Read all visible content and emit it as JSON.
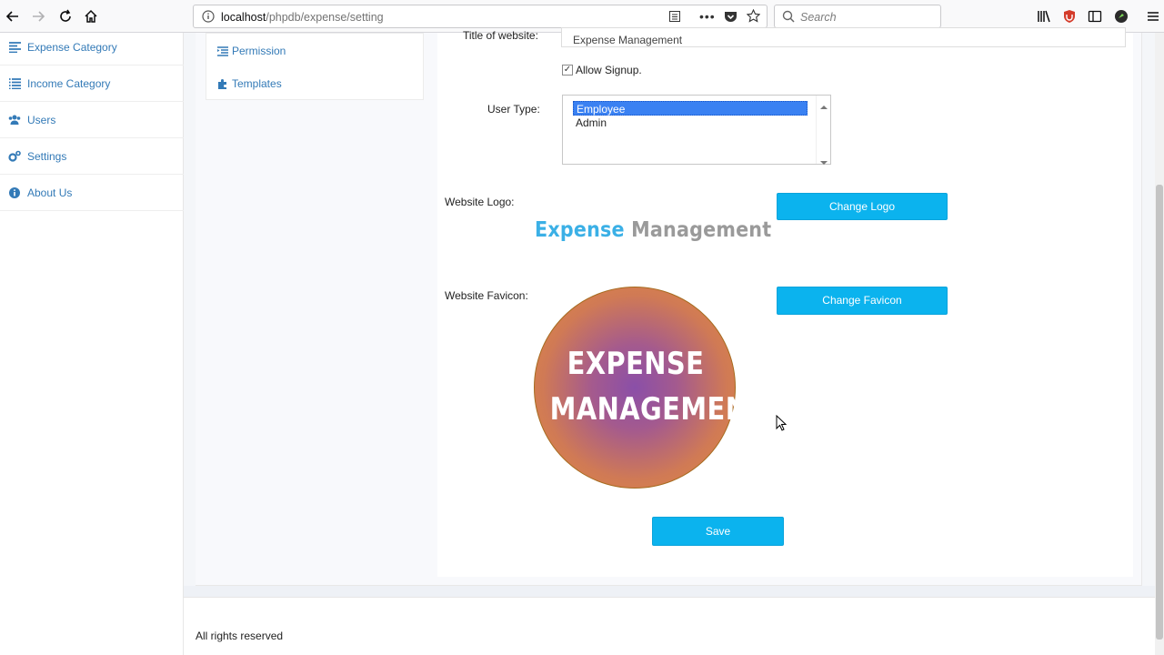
{
  "browser": {
    "url_host": "localhost",
    "url_path": "/phpdb/expense/setting",
    "search_placeholder": "Search"
  },
  "sidebar": {
    "items": [
      {
        "label": "Expense Category",
        "icon": "align-left-icon"
      },
      {
        "label": "Income Category",
        "icon": "list-icon"
      },
      {
        "label": "Users",
        "icon": "users-icon"
      },
      {
        "label": "Settings",
        "icon": "cogs-icon"
      },
      {
        "label": "About Us",
        "icon": "info-circle-icon"
      }
    ]
  },
  "settings_menu": {
    "items": [
      {
        "label": "Permission",
        "icon": "indent-icon"
      },
      {
        "label": "Templates",
        "icon": "puzzle-icon"
      }
    ]
  },
  "form": {
    "title_label": "Title of website:",
    "title_value": "Expense Management",
    "allow_signup_label": "Allow Signup.",
    "allow_signup_checked": true,
    "user_type_label": "User Type:",
    "user_type_options": [
      "Employee",
      "Admin"
    ],
    "user_type_selected": "Employee",
    "logo_label": "Website Logo:",
    "change_logo_label": "Change Logo",
    "logo_text_part1": "Expense",
    "logo_text_part2": "Management",
    "favicon_label": "Website Favicon:",
    "change_favicon_label": "Change Favicon",
    "favicon_line1": "EXPENSE",
    "favicon_line2": "MANAGEMENT",
    "save_label": "Save"
  },
  "footer": {
    "text": "All rights reserved"
  },
  "colors": {
    "accent": "#0bb3ee",
    "link": "#337ab7",
    "selection": "#3a81f2"
  }
}
